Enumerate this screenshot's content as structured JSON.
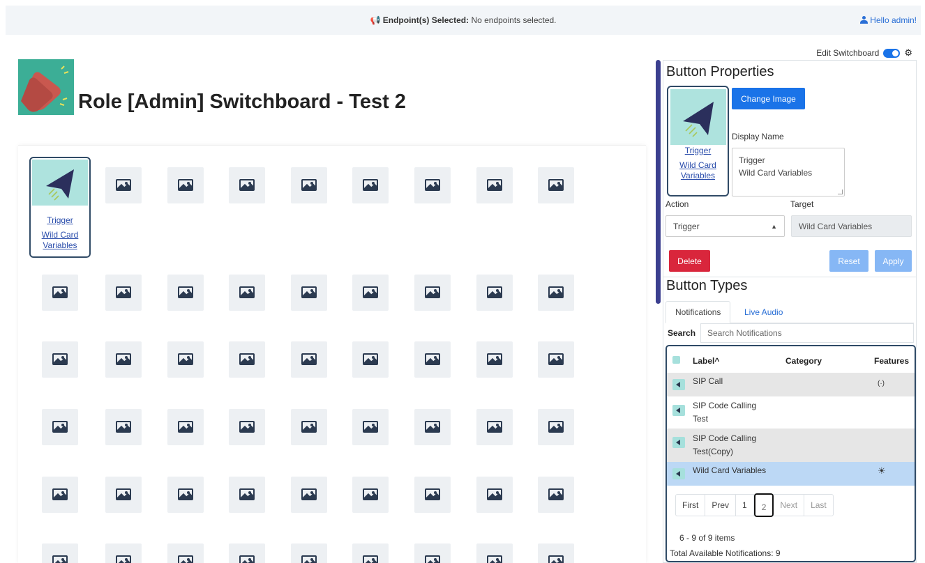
{
  "header": {
    "endpoint_label": "Endpoint(s) Selected:",
    "endpoint_value": "No endpoints selected.",
    "greeting": "Hello admin!"
  },
  "toolbar": {
    "edit_switchboard_label": "Edit Switchboard",
    "edit_switchboard_on": true
  },
  "page": {
    "title": "Role [Admin] Switchboard - Test 2"
  },
  "grid": {
    "selected_button": {
      "line1": "Trigger",
      "line2": "Wild Card",
      "line3": "Variables"
    }
  },
  "properties": {
    "title": "Button Properties",
    "image_caption_line1": "Trigger",
    "image_caption_line2": "Wild Card",
    "image_caption_line3": "Variables",
    "change_image_label": "Change Image",
    "display_name_label": "Display Name",
    "display_name_line1": "Trigger",
    "display_name_line2": "Wild Card Variables",
    "action_label": "Action",
    "action_value": "Trigger",
    "target_label": "Target",
    "target_value": "Wild Card Variables",
    "delete_label": "Delete",
    "reset_label": "Reset",
    "apply_label": "Apply"
  },
  "button_types": {
    "title": "Button Types",
    "tabs": [
      "Notifications",
      "Live Audio"
    ],
    "search_label": "Search",
    "search_placeholder": "Search Notifications",
    "columns": {
      "label": "Label^",
      "category": "Category",
      "features": "Features"
    },
    "rows": [
      {
        "line1": "SIP Call",
        "line2": "",
        "feature": "(·)"
      },
      {
        "line1": "SIP Code Calling",
        "line2": "Test",
        "feature": ""
      },
      {
        "line1": "SIP Code Calling",
        "line2": "Test(Copy)",
        "feature": ""
      },
      {
        "line1": "Wild Card Variables",
        "line2": "",
        "feature": "☀"
      }
    ],
    "pager": {
      "first": "First",
      "prev": "Prev",
      "page1": "1",
      "page2": "2",
      "next": "Next",
      "last": "Last"
    },
    "items_info": "6 - 9 of 9 items",
    "total_info": "Total Available Notifications: 9"
  },
  "colors": {
    "accent": "#1a73e8",
    "danger": "#d9263c",
    "tile_bg": "#edf0f3",
    "image_bg": "#aee3de"
  }
}
